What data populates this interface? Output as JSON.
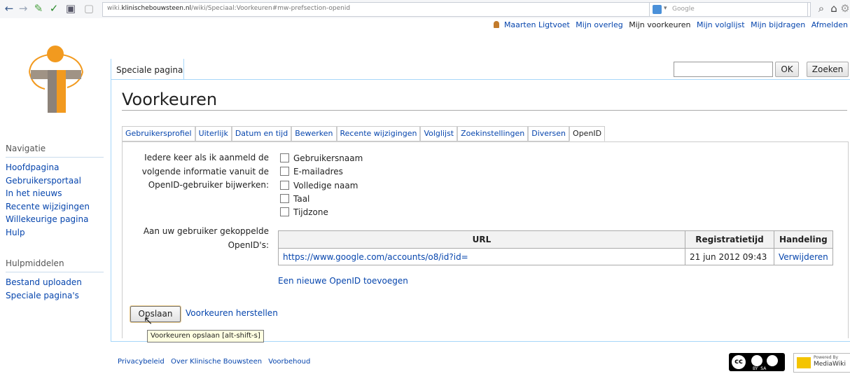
{
  "browser": {
    "url_prefix": "wiki.",
    "url_domain": "klinischebouwsteen.nl",
    "url_path": "/wiki/Speciaal:Voorkeuren#mw-prefsection-openid",
    "search_placeholder": "Google"
  },
  "personal": {
    "user": "Maarten Ligtvoet",
    "links": [
      "Mijn overleg",
      "Mijn voorkeuren",
      "Mijn volglijst",
      "Mijn bijdragen",
      "Afmelden"
    ]
  },
  "sidebar": {
    "navigation_heading": "Navigatie",
    "navigation_items": [
      "Hoofdpagina",
      "Gebruikersportaal",
      "In het nieuws",
      "Recente wijzigingen",
      "Willekeurige pagina",
      "Hulp"
    ],
    "tools_heading": "Hulpmiddelen",
    "tools_items": [
      "Bestand uploaden",
      "Speciale pagina's"
    ]
  },
  "header": {
    "special_tab": "Speciale pagina",
    "ok_button": "OK",
    "search_button": "Zoeken"
  },
  "page_title": "Voorkeuren",
  "pref_tabs": [
    {
      "label": "Gebruikersprofiel"
    },
    {
      "label": "Uiterlijk"
    },
    {
      "label": "Datum en tijd"
    },
    {
      "label": "Bewerken"
    },
    {
      "label": "Recente wijzigingen"
    },
    {
      "label": "Volglijst"
    },
    {
      "label": "Zoekinstellingen"
    },
    {
      "label": "Diversen"
    },
    {
      "label": "OpenID"
    }
  ],
  "openid": {
    "update_label_1": "Iedere keer als ik aanmeld de",
    "update_label_2": "volgende informatie vanuit de",
    "update_label_3": "OpenID-gebruiker bijwerken:",
    "checkboxes": [
      "Gebruikersnaam",
      "E-mailadres",
      "Volledige naam",
      "Taal",
      "Tijdzone"
    ],
    "linked_label_1": "Aan uw gebruiker gekoppelde",
    "linked_label_2": "OpenID's:",
    "table_headers": {
      "url": "URL",
      "time": "Registratietijd",
      "action": "Handeling"
    },
    "row": {
      "url": "https://www.google.com/accounts/o8/id?id=",
      "time": "21 jun 2012 09:43",
      "action": "Verwijderen"
    },
    "add_link": "Een nieuwe OpenID toevoegen"
  },
  "form": {
    "save_button": "Opslaan",
    "reset_link": "Voorkeuren herstellen",
    "tooltip": "Voorkeuren opslaan [alt-shift-s]"
  },
  "footer": {
    "links": [
      "Privacybeleid",
      "Over Klinische Bouwsteen",
      "Voorbehoud"
    ],
    "mw_badge": "MediaWiki",
    "mw_badge_small": "Powered By",
    "cc_badge": "BY  SA"
  },
  "colors": {
    "link": "#0645ad",
    "border": "#a7d7f9",
    "logo_orange": "#f29a1f",
    "logo_grey": "#8c8279"
  }
}
